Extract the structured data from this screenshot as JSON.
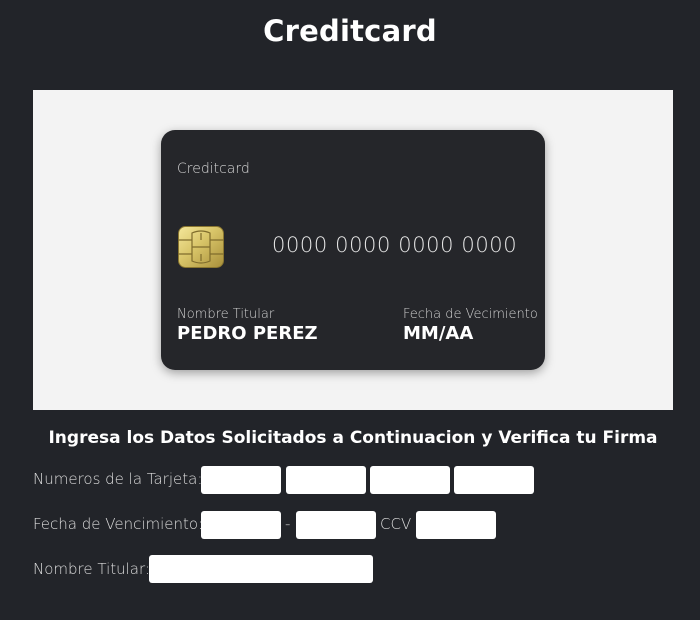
{
  "page": {
    "title": "Creditcard",
    "instructions": "Ingresa los Datos Solicitados a Continuacion y Verifica tu Firma"
  },
  "card": {
    "brand": "Creditcard",
    "number": "0000 0000 0000 0000",
    "holder_label": "Nombre Titular",
    "holder_name": "PEDRO PEREZ",
    "expiry_label": "Fecha de Vecimiento",
    "expiry_value": "MM/AA",
    "chip_icon": "card-chip-icon"
  },
  "form": {
    "card_number_label": "Numeros de la Tarjeta:",
    "expiry_label": "Fecha de Vencimiento:",
    "expiry_separator": "-",
    "ccv_label": "CCV",
    "holder_label": "Nombre Titular:",
    "card_number_groups": [
      "",
      "",
      "",
      ""
    ],
    "expiry_month": "",
    "expiry_year": "",
    "ccv": "",
    "holder_name": ""
  },
  "colors": {
    "background": "#222429",
    "panel": "#f3f3f3",
    "card": "#25262a",
    "chip": "#d9c56a"
  }
}
